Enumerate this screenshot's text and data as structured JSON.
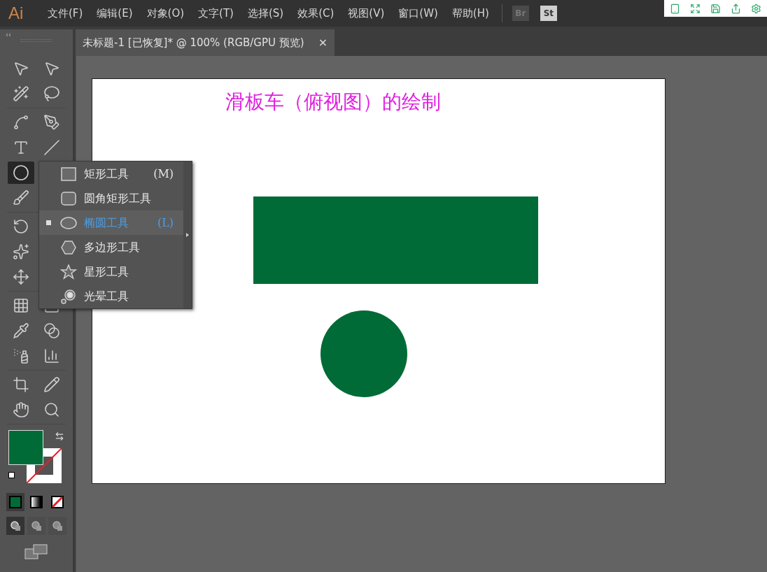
{
  "app_logo": "Ai",
  "menu": [
    "文件(F)",
    "编辑(E)",
    "对象(O)",
    "文字(T)",
    "选择(S)",
    "效果(C)",
    "视图(V)",
    "窗口(W)",
    "帮助(H)"
  ],
  "bridge_buttons": [
    "Br",
    "St"
  ],
  "collapse_glyph": "‹‹",
  "document_tab": {
    "title": "未标题-1 [已恢复]* @ 100% (RGB/GPU 预览)",
    "close": "×"
  },
  "tool_rows": [
    [
      {
        "kind": "selection",
        "selected": false
      },
      {
        "kind": "direct-selection",
        "selected": false
      }
    ],
    [
      {
        "kind": "magic-wand",
        "selected": false
      },
      {
        "kind": "lasso",
        "selected": false
      }
    ],
    [
      {
        "kind": "curvature",
        "selected": false
      },
      {
        "kind": "pen",
        "selected": false
      }
    ],
    [
      {
        "kind": "type",
        "selected": false
      },
      {
        "kind": "line",
        "selected": false
      }
    ],
    [
      {
        "kind": "ellipse",
        "selected": true
      }
    ],
    [
      {
        "kind": "shaper",
        "selected": false
      }
    ],
    [
      {
        "kind": "rotate",
        "selected": false
      }
    ],
    [
      {
        "kind": "warp",
        "selected": false
      }
    ],
    [
      {
        "kind": "free-transform",
        "selected": false
      }
    ],
    [
      {
        "kind": "mesh",
        "selected": false
      },
      {
        "kind": "gradient",
        "selected": false
      }
    ],
    [
      {
        "kind": "eyedropper",
        "selected": false
      },
      {
        "kind": "blend",
        "selected": false
      }
    ],
    [
      {
        "kind": "symbol-sprayer",
        "selected": false
      },
      {
        "kind": "graph",
        "selected": false
      }
    ],
    [
      {
        "kind": "artboard",
        "selected": false
      },
      {
        "kind": "pencil",
        "selected": false
      }
    ],
    [
      {
        "kind": "hand",
        "selected": false
      },
      {
        "kind": "zoom",
        "selected": false
      }
    ]
  ],
  "flyout": [
    {
      "kind": "rectangle",
      "label": "矩形工具",
      "shortcut": "(M)",
      "selected": false
    },
    {
      "kind": "rounded-rectangle",
      "label": "圆角矩形工具",
      "selected": false
    },
    {
      "kind": "ellipse",
      "label": "椭圆工具",
      "shortcut": "(L)",
      "selected": true
    },
    {
      "kind": "polygon",
      "label": "多边形工具",
      "selected": false
    },
    {
      "kind": "star",
      "label": "星形工具",
      "selected": false
    },
    {
      "kind": "flare",
      "label": "光晕工具",
      "selected": false
    }
  ],
  "color_modes": [
    {
      "kind": "color",
      "selected": true
    },
    {
      "kind": "gradient",
      "selected": false
    },
    {
      "kind": "none",
      "selected": false
    }
  ],
  "draw_modes": [
    {
      "selected": true
    },
    {
      "selected": false
    },
    {
      "selected": false
    }
  ],
  "artboard": {
    "title": "滑板车（俯视图）的绘制"
  }
}
